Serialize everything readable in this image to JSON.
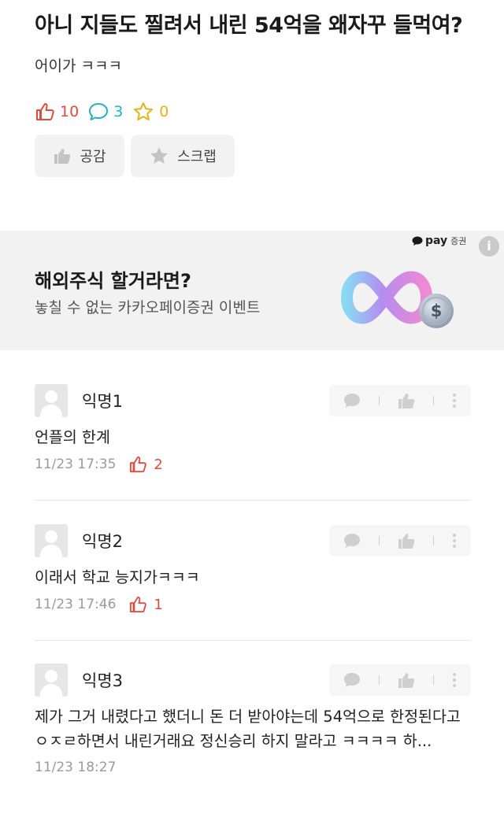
{
  "post": {
    "title": "아니 지들도 찔려서 내린 54억을 왜자꾸 들먹여?",
    "body": "어이가 ㅋㅋㅋ",
    "stats": {
      "likes": "10",
      "comments": "3",
      "scraps": "0"
    },
    "like_button_label": "공감",
    "scrap_button_label": "스크랩"
  },
  "ad": {
    "brand_pay": "pay",
    "brand_suffix": "증권",
    "info_label": "i",
    "title": "해외주식 할거라면?",
    "subtitle": "놓칠 수 없는 카카오페이증권 이벤트",
    "coin_symbol": "$"
  },
  "comments": [
    {
      "author": "익명1",
      "text": "언플의 한계",
      "time": "11/23 17:35",
      "likes": "2"
    },
    {
      "author": "익명2",
      "text": "이래서 학교 능지가ㅋㅋㅋ",
      "time": "11/23 17:46",
      "likes": "1"
    },
    {
      "author": "익명3",
      "text": "제가 그거 내렸다고 했더니 돈 더 받아야는데 54억으로 한정된다고 ㅇㅈㄹ하면서 내린거래요 정신승리 하지 말라고 ㅋㅋㅋㅋ 하...",
      "time": "11/23 18:27",
      "likes": ""
    }
  ],
  "colors": {
    "like": "#e24b3b",
    "comment": "#1fb3c4",
    "scrap": "#e2b416",
    "ad_bg": "#f2f2f2"
  },
  "icons": [
    "thumb-up-outline-icon",
    "speech-bubble-icon",
    "star-outline-icon",
    "thumb-up-filled-icon",
    "star-filled-icon",
    "kakao-pay-bubble-icon",
    "info-icon",
    "infinity-coin-art",
    "reply-bubble-icon",
    "more-vertical-icon",
    "default-avatar-icon"
  ]
}
